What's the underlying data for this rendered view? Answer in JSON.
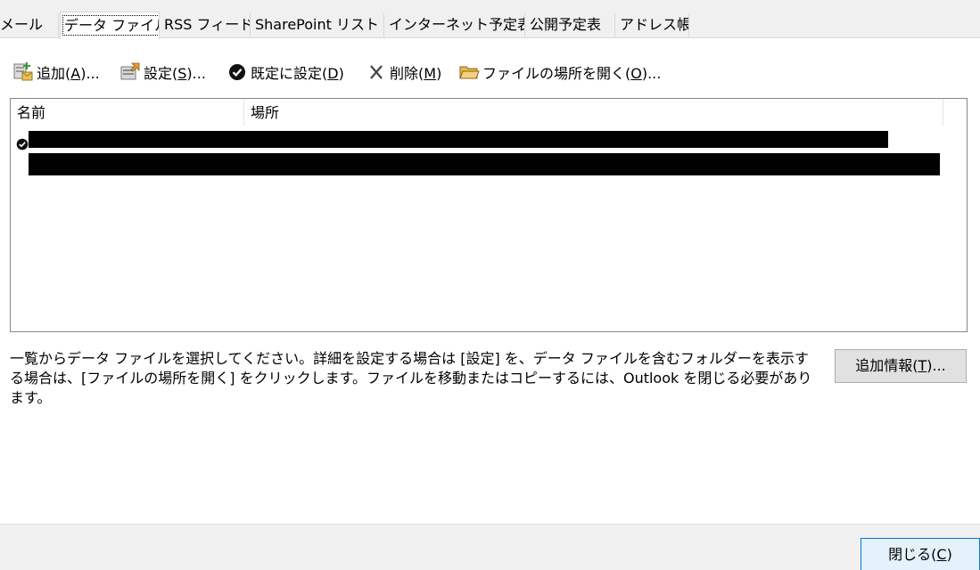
{
  "tabs": [
    {
      "label": "メール",
      "selected": false
    },
    {
      "label": "データ ファイル",
      "selected": true
    },
    {
      "label": "RSS フィード",
      "selected": false
    },
    {
      "label": "SharePoint リスト",
      "selected": false
    },
    {
      "label": "インターネット予定表",
      "selected": false
    },
    {
      "label": "公開予定表",
      "selected": false
    },
    {
      "label": "アドレス帳",
      "selected": false
    }
  ],
  "toolbar": {
    "add": {
      "pre": "追加(",
      "key": "A",
      "post": ")...",
      "icon": "add-data-file-icon"
    },
    "settings": {
      "pre": "設定(",
      "key": "S",
      "post": ")...",
      "icon": "settings-icon"
    },
    "default": {
      "pre": "既定に設定(",
      "key": "D",
      "post": ")",
      "icon": "check-circle-icon"
    },
    "remove": {
      "pre": "削除(",
      "key": "M",
      "post": ")",
      "icon": "remove-x-icon"
    },
    "open_location": {
      "pre": "ファイルの場所を開く(",
      "key": "O",
      "post": ")...",
      "icon": "folder-icon"
    }
  },
  "list": {
    "columns": [
      "名前",
      "場所"
    ],
    "rows": [
      {
        "is_default": true,
        "redacted": true
      }
    ]
  },
  "description": "一覧からデータ ファイルを選択してください。詳細を設定する場合は [設定] を、データ ファイルを含むフォルダーを表示する場合は、[ファイルの場所を開く] をクリックします。ファイルを移動またはコピーするには、Outlook を閉じる必要があります。",
  "more_info": {
    "pre": "追加情報(",
    "key": "T",
    "post": ")..."
  },
  "close": {
    "pre": "閉じる(",
    "key": "C",
    "post": ")"
  },
  "colors": {
    "accent": "#0078d7",
    "panel": "#f0f0f0",
    "button": "#e1e1e1"
  }
}
